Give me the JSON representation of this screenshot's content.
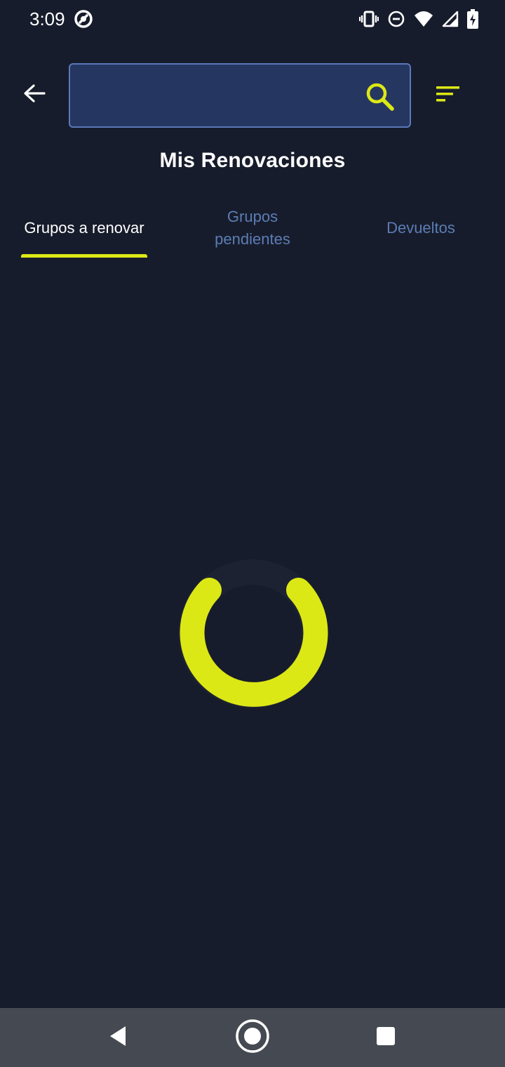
{
  "status_bar": {
    "time": "3:09",
    "icons": [
      "app-notification-icon",
      "vibrate-icon",
      "do-not-disturb-icon",
      "wifi-icon",
      "cell-signal-icon",
      "battery-charging-icon"
    ]
  },
  "header": {
    "back_icon": "arrow-left-icon",
    "search": {
      "value": "",
      "placeholder": "",
      "icon": "search-icon"
    },
    "filter_icon": "filter-list-icon"
  },
  "page": {
    "title": "Mis Renovaciones"
  },
  "tabs": [
    {
      "label": "Grupos a renovar",
      "selected": true
    },
    {
      "label": "Grupos pendientes",
      "selected": false
    },
    {
      "label": "Devueltos",
      "selected": false
    }
  ],
  "loading": {
    "visible": true
  },
  "colors": {
    "background": "#171c2c",
    "accent": "#dce815",
    "search_background": "#253760",
    "search_border": "#5a79b8",
    "tab_inactive": "#5b7db3",
    "nav_bar": "#454a52"
  },
  "nav_bar": {
    "buttons": [
      "nav-back-icon",
      "nav-home-icon",
      "nav-recents-icon"
    ]
  }
}
